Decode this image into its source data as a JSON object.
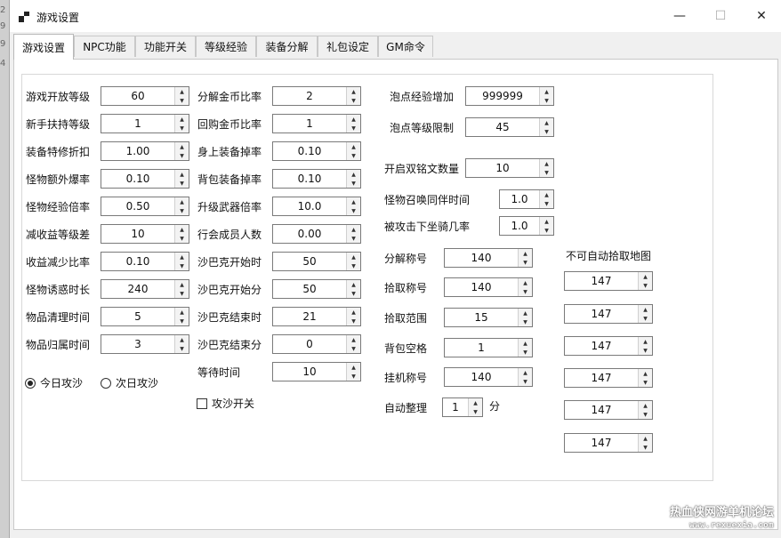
{
  "window": {
    "title": "游戏设置",
    "controls": {
      "minimize": "—",
      "maximize": "☐",
      "close": "✕"
    }
  },
  "edge_fragments": [
    "2",
    "9",
    "9",
    "4"
  ],
  "tabs": [
    "游戏设置",
    "NPC功能",
    "功能开关",
    "等级经验",
    "装备分解",
    "礼包设定",
    "GM命令"
  ],
  "active_tab": "游戏设置",
  "col1": [
    {
      "label": "游戏开放等级",
      "value": "60"
    },
    {
      "label": "新手扶持等级",
      "value": "1"
    },
    {
      "label": "装备特修折扣",
      "value": "1.00"
    },
    {
      "label": "怪物额外爆率",
      "value": "0.10"
    },
    {
      "label": "怪物经验倍率",
      "value": "0.50"
    },
    {
      "label": "减收益等级差",
      "value": "10"
    },
    {
      "label": "收益减少比率",
      "value": "0.10"
    },
    {
      "label": "怪物诱惑时长",
      "value": "240"
    },
    {
      "label": "物品清理时间",
      "value": "5"
    },
    {
      "label": "物品归属时间",
      "value": "3"
    }
  ],
  "col2": [
    {
      "label": "分解金币比率",
      "value": "2"
    },
    {
      "label": "回购金币比率",
      "value": "1"
    },
    {
      "label": "身上装备掉率",
      "value": "0.10"
    },
    {
      "label": "背包装备掉率",
      "value": "0.10"
    },
    {
      "label": "升级武器倍率",
      "value": "10.0"
    },
    {
      "label": "行会成员人数",
      "value": "0.00"
    },
    {
      "label": "沙巴克开始时",
      "value": "50"
    },
    {
      "label": "沙巴克开始分",
      "value": "50"
    },
    {
      "label": "沙巴克结束时",
      "value": "21"
    },
    {
      "label": "沙巴克结束分",
      "value": "0"
    },
    {
      "label": "等待时间",
      "value": "10"
    }
  ],
  "col3": [
    {
      "label": "泡点经验增加",
      "value": "999999"
    },
    {
      "label": "泡点等级限制",
      "value": "45"
    },
    {
      "label": "开启双铭文数量",
      "value": "10"
    },
    {
      "label": "怪物召唤同伴时间",
      "value": "1.0"
    },
    {
      "label": "被攻击下坐骑几率",
      "value": "1.0"
    },
    {
      "label": "分解称号",
      "value": "140"
    },
    {
      "label": "拾取称号",
      "value": "140"
    },
    {
      "label": "拾取范围",
      "value": "15"
    },
    {
      "label": "背包空格",
      "value": "1"
    },
    {
      "label": "挂机称号",
      "value": "140"
    }
  ],
  "auto_sort": {
    "label": "自动整理",
    "value": "1",
    "unit": "分"
  },
  "radios": [
    {
      "label": "今日攻沙",
      "checked": true
    },
    {
      "label": "次日攻沙",
      "checked": false
    }
  ],
  "checkbox": {
    "label": "攻沙开关",
    "checked": false
  },
  "no_autopickup": {
    "title": "不可自动拾取地图",
    "values": [
      "147",
      "147",
      "147",
      "147",
      "147",
      "147"
    ]
  },
  "watermark": {
    "line1": "热血侠网游单机论坛",
    "line2": "www.rexuexia.com"
  }
}
